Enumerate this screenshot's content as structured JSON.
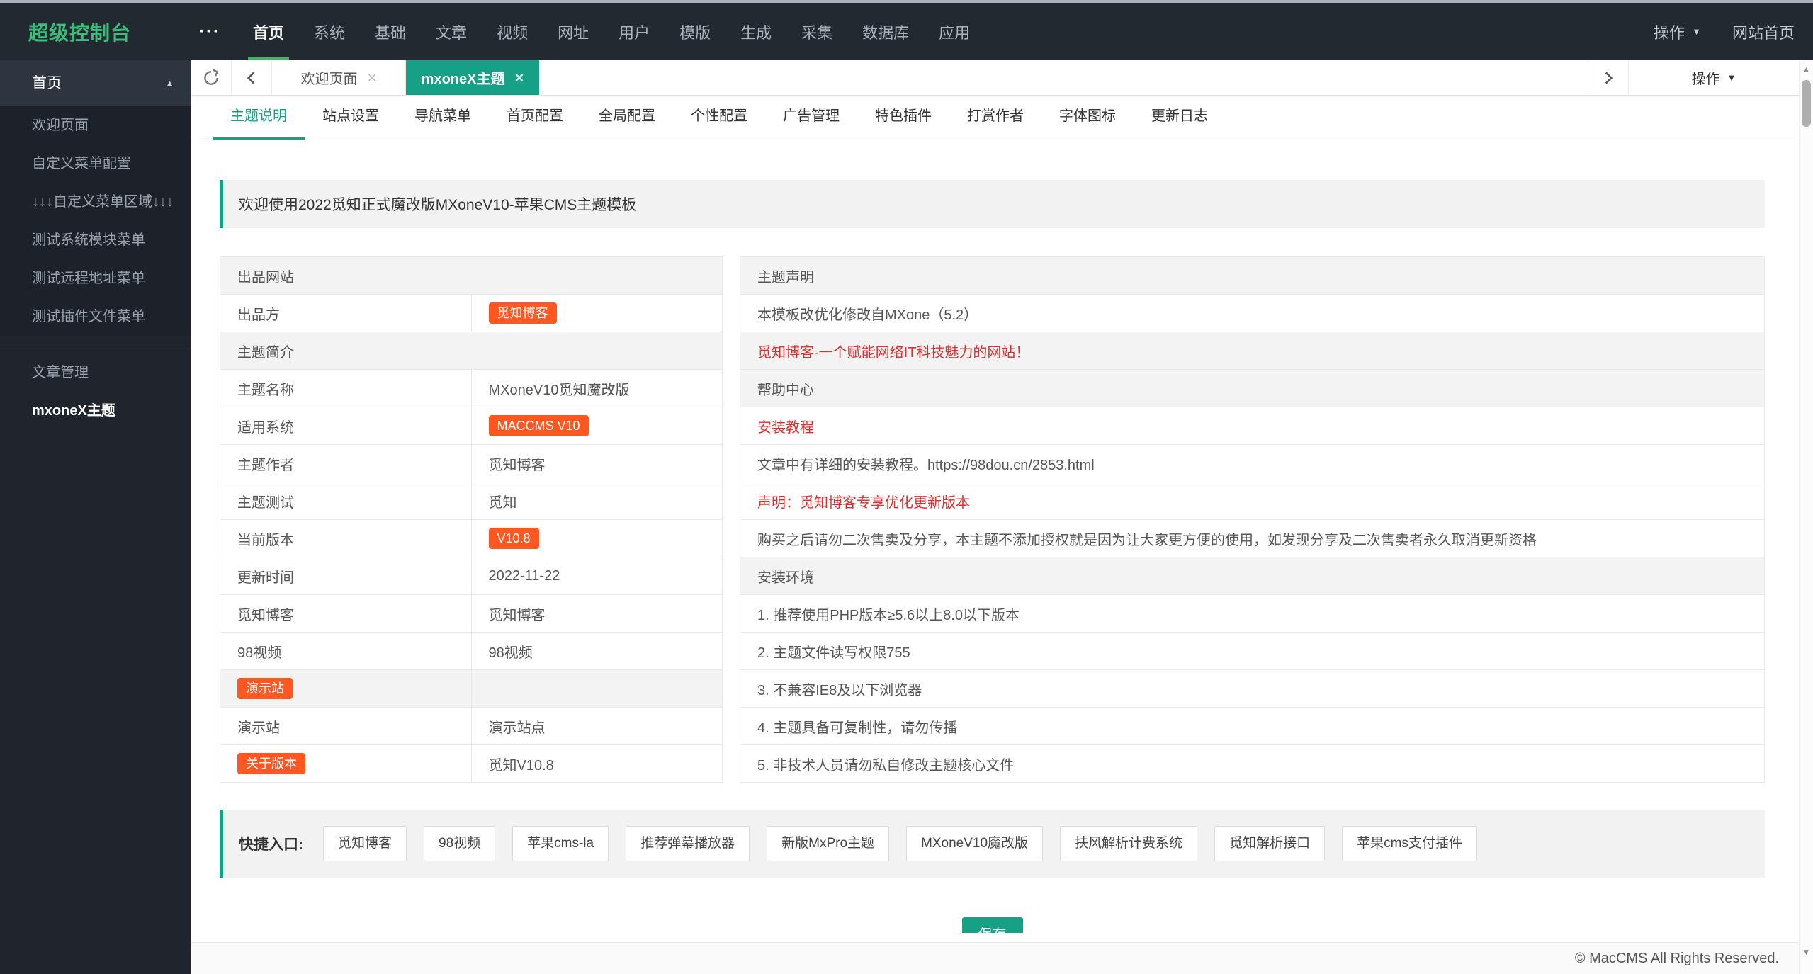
{
  "topbar": {
    "logo": "超级控制台",
    "menu": [
      "首页",
      "系统",
      "基础",
      "文章",
      "视频",
      "网址",
      "用户",
      "模版",
      "生成",
      "采集",
      "数据库",
      "应用"
    ],
    "active_menu": "首页",
    "action": "操作",
    "site_home": "网站首页"
  },
  "sidebar": {
    "group": "首页",
    "items": [
      "欢迎页面",
      "自定义菜单配置",
      "↓↓↓自定义菜单区域↓↓↓",
      "测试系统模块菜单",
      "测试远程地址菜单",
      "测试插件文件菜单"
    ],
    "section2": "文章管理",
    "active_item": "mxoneX主题"
  },
  "tabstrip": {
    "tab1": "欢迎页面",
    "tab2": "mxoneX主题",
    "active_tab": "mxoneX主题",
    "action": "操作"
  },
  "subnav": [
    "主题说明",
    "站点设置",
    "导航菜单",
    "首页配置",
    "全局配置",
    "个性配置",
    "广告管理",
    "特色插件",
    "打赏作者",
    "字体图标",
    "更新日志"
  ],
  "subnav_active": "主题说明",
  "alert": "欢迎使用2022觅知正式魔改版MXoneV10-苹果CMS主题模板",
  "info_rows": [
    {
      "h": "出品网站"
    },
    {
      "label": "出品方",
      "value": "觅知博客"
    },
    {
      "h": "主题简介"
    },
    {
      "label": "主题名称",
      "value": "MXoneV10觅知魔改版"
    },
    {
      "label": "适用系统",
      "value": "MACCMS V10"
    },
    {
      "label": "主题作者",
      "value": "觅知博客"
    },
    {
      "label": "主题测试",
      "value": "觅知"
    },
    {
      "label": "当前版本",
      "value": "V10.8"
    },
    {
      "label": "更新时间",
      "value": "2022-11-22"
    },
    {
      "label": "觅知博客",
      "value": "觅知博客"
    },
    {
      "label": "98视频",
      "value": "98视频"
    },
    {
      "label": "演示站",
      "value": ""
    },
    {
      "label": "演示站",
      "value": "演示站点"
    },
    {
      "label": "关于版本",
      "value": "觅知V10.8"
    }
  ],
  "theme_notes": [
    "主题声明",
    "本模板改优化修改自MXone（5.2）",
    "觅知博客-一个赋能网络IT科技魅力的网站！",
    "帮助中心",
    "安装教程",
    "文章中有详细的安装教程。https://98dou.cn/2853.html",
    "声明：觅知博客专享优化更新版本",
    "购买之后请勿二次售卖及分享，本主题不添加授权就是因为让大家更方便的使用，如发现分享及二次售卖者永久取消更新资格",
    "安装环境",
    "1. 推荐使用PHP版本≥5.6以上8.0以下版本",
    "2. 主题文件读写权限755",
    "3. 不兼容IE8及以下浏览器",
    "4. 主题具备可复制性，请勿传播",
    "5. 非技术人员请勿私自修改主题核心文件"
  ],
  "quick": {
    "label": "快捷入口:",
    "buttons": [
      "觅知博客",
      "98视频",
      "苹果cms-la",
      "推荐弹幕播放器",
      "新版MxPro主题",
      "MXoneV10魔改版",
      "扶风解析计费系统",
      "觅知解析接口",
      "苹果cms支付插件"
    ]
  },
  "save_label": "保存",
  "footer": "© MacCMS All Rights Reserved.",
  "icons": {
    "more": "···",
    "caret_up": "▲",
    "caret_down": "▼",
    "close": "×",
    "scroll_up": "▲",
    "scroll_down": "▼"
  },
  "colors": {
    "accent_teal": "#16a085",
    "topbar_green": "#4cae6e",
    "logo_green": "#3dbd7b",
    "badge_orange": "#ff5722",
    "warning_red": "#e02d2d",
    "topbar_bg": "#232931",
    "sidebar_bg": "#20252d"
  }
}
